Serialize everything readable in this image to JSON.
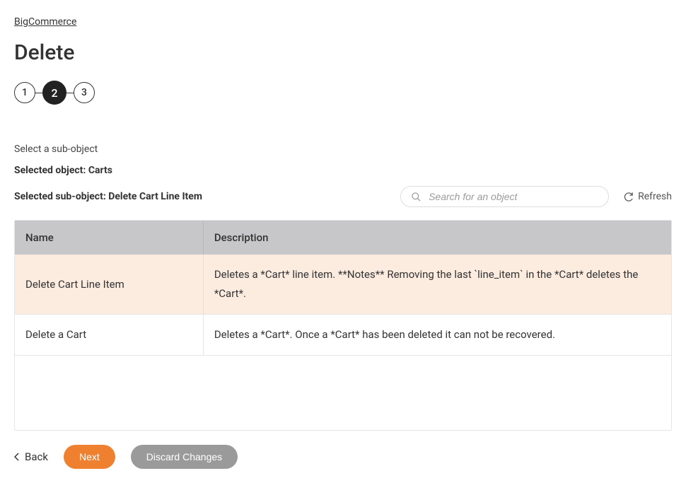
{
  "breadcrumb": "BigCommerce",
  "page_title": "Delete",
  "stepper": {
    "steps": [
      "1",
      "2",
      "3"
    ],
    "active_index": 1
  },
  "info_line": "Select a sub-object",
  "selected_object_label": "Selected object: Carts",
  "selected_subobject_label": "Selected sub-object: Delete Cart Line Item",
  "search": {
    "placeholder": "Search for an object"
  },
  "refresh_label": "Refresh",
  "table": {
    "columns": {
      "name": "Name",
      "description": "Description"
    },
    "rows": [
      {
        "name": "Delete Cart Line Item",
        "description": "Deletes a *Cart* line item. **Notes** Removing the last `line_item` in the *Cart* deletes the *Cart*.",
        "selected": true
      },
      {
        "name": "Delete a Cart",
        "description": "Deletes a *Cart*. Once a *Cart* has been deleted it can not be recovered.",
        "selected": false
      }
    ]
  },
  "footer": {
    "back_label": "Back",
    "next_label": "Next",
    "discard_label": "Discard Changes"
  }
}
